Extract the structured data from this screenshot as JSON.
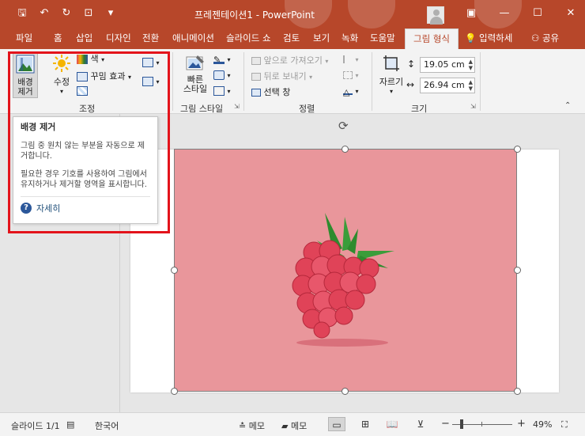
{
  "window": {
    "title": "프레젠테이션1  -  PowerPoint",
    "accent_color": "#b7472a",
    "controls": {
      "ribbon_display": "▣",
      "minimize": "—",
      "maximize": "☐",
      "close": "✕"
    }
  },
  "quick_access": [
    {
      "name": "save-icon",
      "glyph": "🖫"
    },
    {
      "name": "undo-icon",
      "glyph": "↶"
    },
    {
      "name": "redo-icon",
      "glyph": "↻"
    },
    {
      "name": "present-icon",
      "glyph": "⊡"
    },
    {
      "name": "customize-icon",
      "glyph": "▾"
    }
  ],
  "tabs": [
    {
      "label": "파일",
      "active": false
    },
    {
      "label": "홈",
      "active": false
    },
    {
      "label": "삽입",
      "active": false
    },
    {
      "label": "디자인",
      "active": false
    },
    {
      "label": "전환",
      "active": false
    },
    {
      "label": "애니메이션",
      "active": false
    },
    {
      "label": "슬라이드 쇼",
      "active": false
    },
    {
      "label": "검토",
      "active": false
    },
    {
      "label": "보기",
      "active": false
    },
    {
      "label": "녹화",
      "active": false
    },
    {
      "label": "도움말",
      "active": false
    },
    {
      "label": "그림 형식",
      "active": true
    }
  ],
  "tell_me": "입력하세",
  "share": "공유",
  "ribbon": {
    "adjust": {
      "remove_background": "배경\n제거",
      "corrections": "수정",
      "color": "색",
      "artistic_effects": "꾸밈 효과",
      "group_label": "조정"
    },
    "picture_styles": {
      "quick_styles": "빠른\n스타일",
      "group_label": "그림 스타일"
    },
    "arrange": {
      "bring_forward": "앞으로 가져오기",
      "send_backward": "뒤로 보내기",
      "selection_pane": "선택 창",
      "group_label": "정렬"
    },
    "size": {
      "crop": "자르기",
      "height": "19.05 cm",
      "width": "26.94 cm",
      "group_label": "크기"
    }
  },
  "tooltip": {
    "title": "배경 제거",
    "para1": "그림 중 원치 않는 부분을 자동으로 제거합니다.",
    "para2": "필요한 경우 기호를 사용하여 그림에서 유지하거나 제거할 영역을 표시합니다.",
    "more_info": "자세히"
  },
  "slide": {
    "picture_bg_color": "#e9969b",
    "berry_color": "#e04358",
    "leaf_color": "#2e8b2e"
  },
  "status": {
    "slide_counter": "슬라이드 1/1",
    "language": "한국어",
    "notes": "메모",
    "comments": "메모",
    "zoom": "49%"
  }
}
